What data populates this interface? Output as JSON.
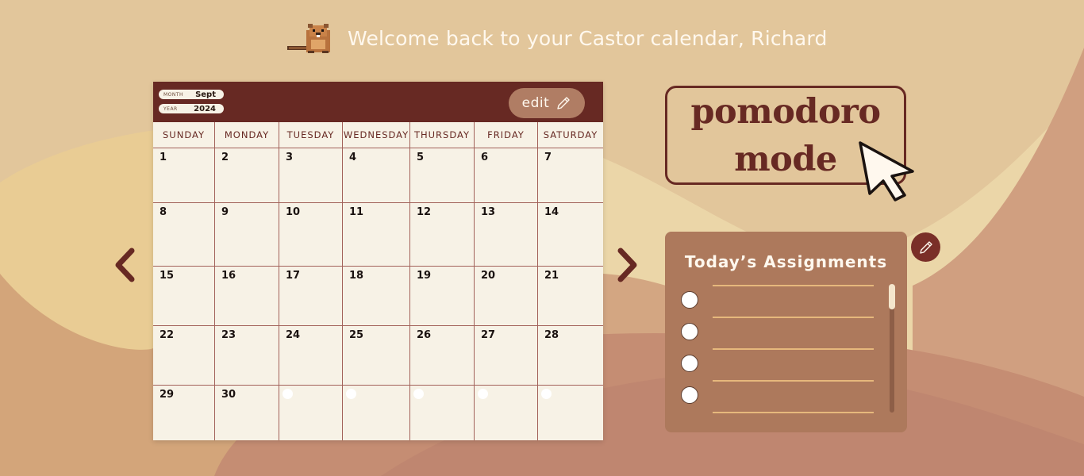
{
  "header": {
    "welcome_text": "Welcome back to your Castor calendar, Richard",
    "logo_icon": "beaver-icon"
  },
  "calendar": {
    "month_key": "MONTH",
    "month_value": "Sept",
    "year_key": "YEAR",
    "year_value": "2024",
    "edit_label": "edit",
    "edit_icon": "pencil-icon",
    "weekdays": [
      "SUNDAY",
      "MONDAY",
      "TUESDAY",
      "WEDNESDAY",
      "THURSDAY",
      "FRIDAY",
      "SATURDAY"
    ],
    "days": [
      "1",
      "2",
      "3",
      "4",
      "5",
      "6",
      "7",
      "8",
      "9",
      "10",
      "11",
      "12",
      "13",
      "14",
      "15",
      "16",
      "17",
      "18",
      "19",
      "20",
      "21",
      "22",
      "23",
      "24",
      "25",
      "26",
      "27",
      "28",
      "29",
      "30"
    ]
  },
  "navigation": {
    "prev_icon": "chevron-left-icon",
    "next_icon": "chevron-right-icon"
  },
  "pomodoro": {
    "line1": "pomodoro",
    "line2": "mode",
    "cursor_icon": "pointer-cursor-icon"
  },
  "assignments": {
    "title": "Today’s Assignments",
    "task_count_visible": 4,
    "edit_icon": "pencil-icon"
  },
  "colors": {
    "primary": "#672923",
    "paper": "#f7f2e6",
    "panel": "#ad795c",
    "accent_line": "#e6b87c",
    "background": "#e2c69b"
  }
}
